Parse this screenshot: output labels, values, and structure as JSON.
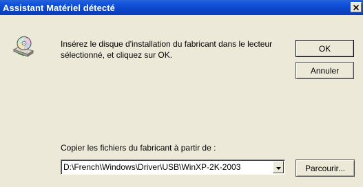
{
  "window": {
    "title": "Assistant Matériel détecté",
    "close_icon": "close-icon"
  },
  "main": {
    "icon": "cd-disk-icon",
    "message": "Insérez le disque d'installation du fabricant dans le lecteur sélectionné, et cliquez sur OK."
  },
  "buttons": {
    "ok_label": "OK",
    "cancel_label": "Annuler",
    "browse_label": "Parcourir..."
  },
  "copy_from": {
    "label": "Copier les fichiers du fabricant à partir de :",
    "value": "D:\\French\\Windows\\Driver\\USB\\WinXP-2K-2003",
    "arrow_icon": "chevron-down-icon"
  },
  "colors": {
    "titlebar": "#0a3cb4",
    "dialog_background": "#ece9d8"
  }
}
